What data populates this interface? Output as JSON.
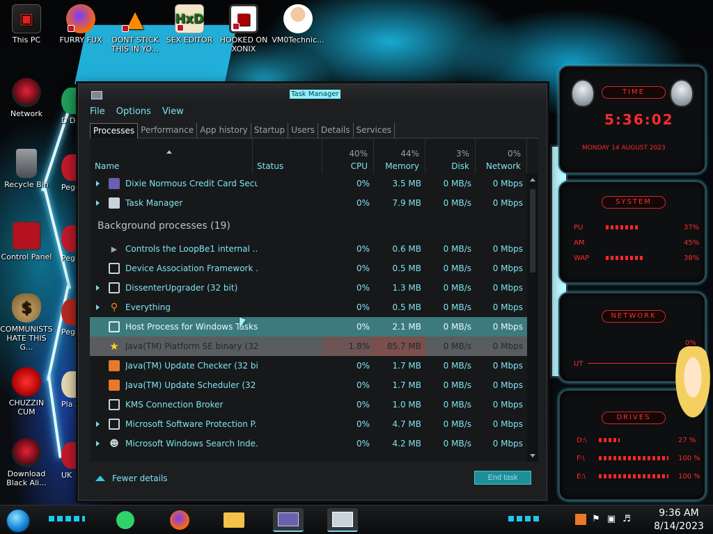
{
  "desktop": {
    "icons": [
      {
        "label": "This PC"
      },
      {
        "label": "FURRY FUX"
      },
      {
        "label": "DONT STICK THIS IN YO..."
      },
      {
        "label": "SEX EDITOR"
      },
      {
        "label": "HOOKED ON XONIX"
      },
      {
        "label": "VM0Technic..."
      },
      {
        "label": "Network"
      },
      {
        "label": "Recycle Bin"
      },
      {
        "label": "Control Panel"
      },
      {
        "label": "COMMUNISTS HATE THIS G..."
      },
      {
        "label": "CHUZZIN CUM"
      },
      {
        "label": "Download Black Ali..."
      }
    ],
    "peek": [
      "D DU",
      "Pegg",
      "Pegg De",
      "Pegg of Wa",
      "Pla Zo",
      "UK"
    ]
  },
  "taskmgr": {
    "title": "Task Manager",
    "menu": [
      "File",
      "Options",
      "View"
    ],
    "tabs": [
      "Processes",
      "Performance",
      "App history",
      "Startup",
      "Users",
      "Details",
      "Services"
    ],
    "columns": {
      "name": "Name",
      "status": "Status",
      "cpu": {
        "pct": "40%",
        "label": "CPU"
      },
      "memory": {
        "pct": "44%",
        "label": "Memory"
      },
      "disk": {
        "pct": "3%",
        "label": "Disk"
      },
      "network": {
        "pct": "0%",
        "label": "Network"
      }
    },
    "apps": [
      {
        "name": "Dixie Normous Credit Card Secu...",
        "cpu": "0%",
        "memory": "3.5 MB",
        "disk": "0 MB/s",
        "network": "0 Mbps"
      },
      {
        "name": "Task Manager",
        "cpu": "0%",
        "memory": "7.9 MB",
        "disk": "0 MB/s",
        "network": "0 Mbps"
      }
    ],
    "group_label": "Background processes (19)",
    "background": [
      {
        "name": "Controls the LoopBe1 internal ...",
        "cpu": "0%",
        "memory": "0.6 MB",
        "disk": "0 MB/s",
        "network": "0 Mbps"
      },
      {
        "name": "Device Association Framework ...",
        "cpu": "0%",
        "memory": "0.5 MB",
        "disk": "0 MB/s",
        "network": "0 Mbps"
      },
      {
        "name": "DissenterUpgrader (32 bit)",
        "cpu": "0%",
        "memory": "1.3 MB",
        "disk": "0 MB/s",
        "network": "0 Mbps"
      },
      {
        "name": "Everything",
        "cpu": "0%",
        "memory": "0.5 MB",
        "disk": "0 MB/s",
        "network": "0 Mbps"
      },
      {
        "name": "Host Process for Windows Tasks",
        "cpu": "0%",
        "memory": "2.1 MB",
        "disk": "0 MB/s",
        "network": "0 Mbps"
      },
      {
        "name": "Java(TM) Platform SE binary (32...",
        "cpu": "1.8%",
        "memory": "85.7 MB",
        "disk": "0 MB/s",
        "network": "0 Mbps"
      },
      {
        "name": "Java(TM) Update Checker (32 bit)",
        "cpu": "0%",
        "memory": "1.7 MB",
        "disk": "0 MB/s",
        "network": "0 Mbps"
      },
      {
        "name": "Java(TM) Update Scheduler (32 ...",
        "cpu": "0%",
        "memory": "1.7 MB",
        "disk": "0 MB/s",
        "network": "0 Mbps"
      },
      {
        "name": "KMS Connection Broker",
        "cpu": "0%",
        "memory": "1.0 MB",
        "disk": "0 MB/s",
        "network": "0 Mbps"
      },
      {
        "name": "Microsoft Software Protection P...",
        "cpu": "0%",
        "memory": "4.7 MB",
        "disk": "0 MB/s",
        "network": "0 Mbps"
      },
      {
        "name": "Microsoft Windows Search Inde...",
        "cpu": "0%",
        "memory": "4.2 MB",
        "disk": "0 MB/s",
        "network": "0 Mbps"
      }
    ],
    "fewer_details": "Fewer details",
    "end_task": "End task"
  },
  "hud": {
    "time_title": "TIME",
    "time": "5:36:02",
    "date": "MONDAY 14 AUGUST 2023",
    "system_title": "SYSTEM",
    "system": [
      {
        "label": "PU",
        "value": "37%"
      },
      {
        "label": "AM",
        "value": "45%"
      },
      {
        "label": "WAP",
        "value": "38%"
      }
    ],
    "network_title": "NETWORK",
    "network_values": [
      "0%",
      "UT"
    ],
    "drives_title": "DRIVES",
    "drives": [
      {
        "label": "D:\\",
        "value": "27 %"
      },
      {
        "label": "F:\\",
        "value": "100 %"
      },
      {
        "label": "E:\\",
        "value": "100 %"
      }
    ]
  },
  "taskbar": {
    "time": "9:36 AM",
    "date": "8/14/2023"
  },
  "colors": {
    "accent": "#7fe3f3",
    "selected_row": "#3c7a7d",
    "hud_red": "#ff2a2a"
  }
}
